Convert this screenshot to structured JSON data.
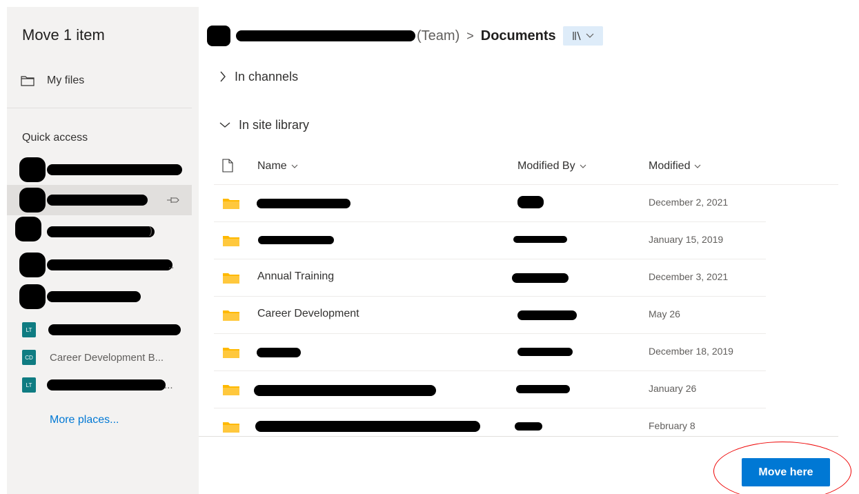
{
  "dialog": {
    "title": "Move 1 item"
  },
  "sidebar": {
    "my_files_label": "My files",
    "quick_access_label": "Quick access",
    "quick_access_items": [
      {
        "label": "",
        "avatar": "round"
      },
      {
        "label": "",
        "avatar": "round",
        "selected": true,
        "pinned": true
      },
      {
        "label": ")",
        "avatar": "round"
      },
      {
        "label": "..",
        "avatar": "round"
      },
      {
        "label": "",
        "avatar": "round"
      },
      {
        "label": "",
        "avatar": "square",
        "initials": "LT"
      },
      {
        "label": "Career Development B...",
        "avatar": "square",
        "initials": "CD"
      },
      {
        "label": "...",
        "avatar": "square",
        "initials": "LT"
      }
    ],
    "more_places_label": "More places..."
  },
  "breadcrumb": {
    "team_suffix": "(Team)",
    "separator": ">",
    "current": "Documents"
  },
  "sections": {
    "in_channels": "In channels",
    "in_site_library": "In site library"
  },
  "table": {
    "headers": {
      "name": "Name",
      "modified_by": "Modified By",
      "modified": "Modified"
    },
    "rows": [
      {
        "name": "",
        "modified": "December 2, 2021"
      },
      {
        "name": "",
        "modified": "January 15, 2019"
      },
      {
        "name": "Annual Training",
        "modified": "December 3, 2021"
      },
      {
        "name": "Career Development",
        "modified": "May 26"
      },
      {
        "name": "",
        "modified": "December 18, 2019"
      },
      {
        "name": "",
        "modified": "January 26"
      },
      {
        "name": "",
        "modified": "February 8"
      }
    ]
  },
  "footer": {
    "move_here_label": "Move here"
  },
  "colors": {
    "accent": "#0078d4",
    "folder": "#ffb900",
    "team_avatar": "#0f7c82",
    "highlight": "#e00000"
  }
}
